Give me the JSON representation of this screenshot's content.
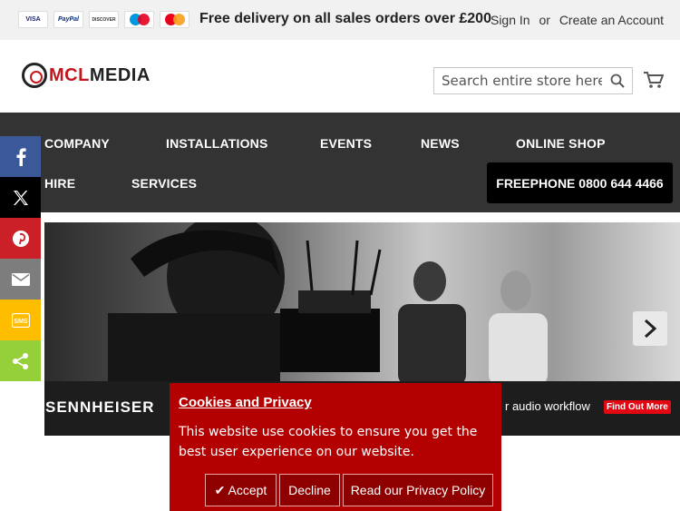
{
  "topbar": {
    "payment_cards": [
      "VISA",
      "PayPal",
      "DISCOVER",
      "Maestro",
      "MasterCard"
    ],
    "delivery_text": "Free delivery on all sales orders over £200",
    "sign_in": "Sign In",
    "or": "or",
    "create_account": "Create an Account"
  },
  "header": {
    "logo_mcl": "MCL",
    "logo_media": "MEDIA",
    "search_placeholder": "Search entire store here...",
    "search_icon": "search-icon",
    "cart_icon": "cart-icon"
  },
  "nav": {
    "items": [
      "COMPANY",
      "INSTALLATIONS",
      "EVENTS",
      "NEWS",
      "ONLINE SHOP",
      "HIRE",
      "SERVICES"
    ],
    "freephone": "FREEPHONE 0800 644 4466"
  },
  "share": {
    "items": [
      {
        "icon": "facebook-icon",
        "color": "#3b5998"
      },
      {
        "icon": "x-icon",
        "color": "#000000"
      },
      {
        "icon": "pinterest-icon",
        "color": "#cb2027"
      },
      {
        "icon": "email-icon",
        "color": "#7d7d7d"
      },
      {
        "icon": "sms-icon",
        "color": "#ffbd00"
      },
      {
        "icon": "share-icon",
        "color": "#95d03a"
      }
    ]
  },
  "hero": {
    "brand": "SENNHEISER",
    "tagline": "r audio workflow",
    "cta": "Find Out More"
  },
  "cookie": {
    "title": "Cookies and Privacy",
    "body": "This website use cookies to ensure you get the best user experience on our website.",
    "accept": "✔ Accept",
    "decline": "Decline",
    "privacy": "Read our Privacy Policy"
  },
  "colors": {
    "nav_bg": "#333333",
    "cookie_bg": "#b30000",
    "brand_red": "#c4161c"
  }
}
